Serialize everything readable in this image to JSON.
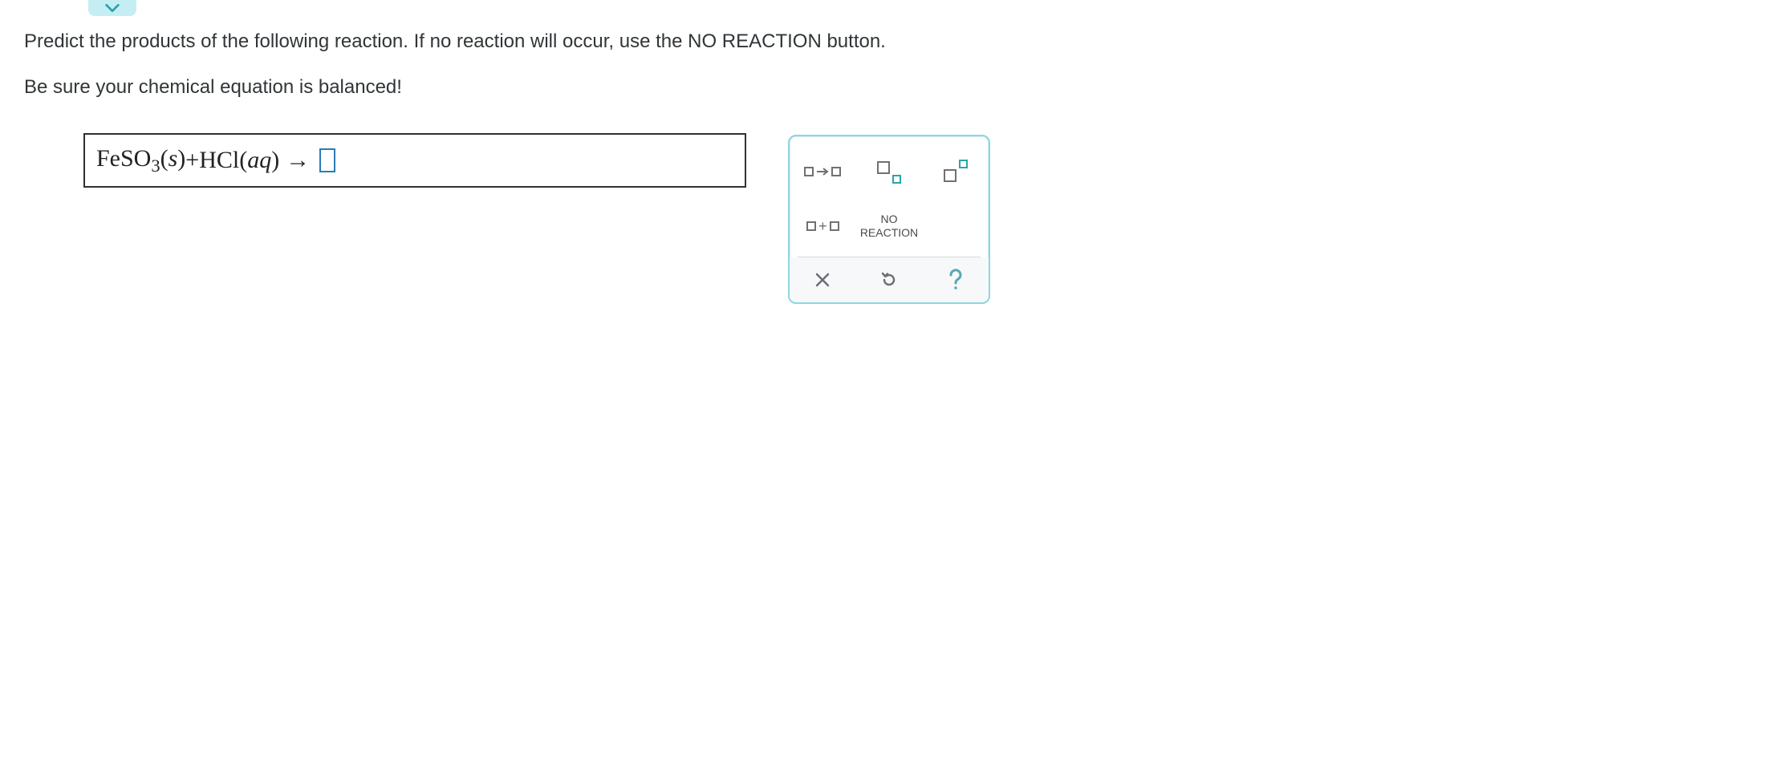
{
  "question": {
    "line1": "Predict the products of the following reaction. If no reaction will occur, use the NO REACTION button.",
    "line2": "Be sure your chemical equation is balanced!"
  },
  "equation": {
    "reactant1_formula": "FeSO",
    "reactant1_sub": "3",
    "reactant1_state": "s",
    "plus": " + ",
    "reactant2_formula": "HCl",
    "reactant2_state": "aq",
    "arrow": "→"
  },
  "toolpanel": {
    "no_reaction_line1": "NO",
    "no_reaction_line2": "REACTION"
  }
}
